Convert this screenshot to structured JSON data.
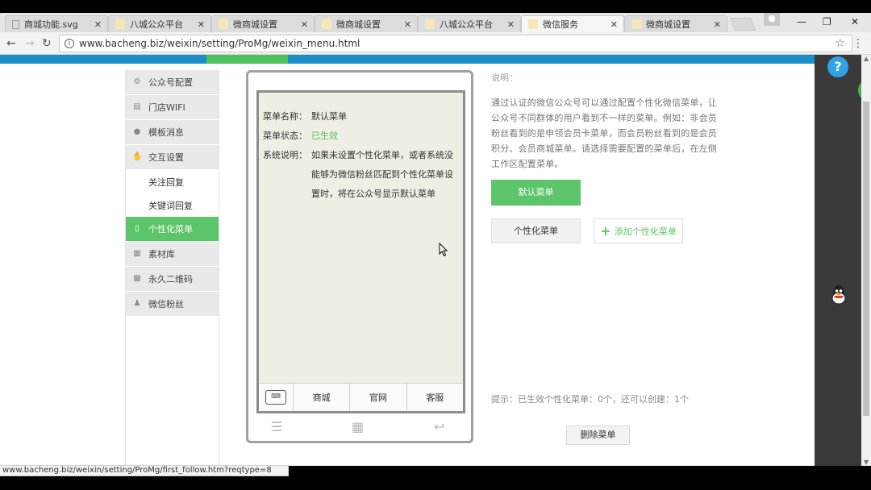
{
  "browser": {
    "tabs": [
      {
        "title": "商城功能.svg",
        "icon": "page-icon",
        "active": false
      },
      {
        "title": "八城公众平台",
        "icon": "site-icon",
        "active": false
      },
      {
        "title": "微商城设置",
        "icon": "site-icon",
        "active": false
      },
      {
        "title": "微商城设置",
        "icon": "site-icon",
        "active": false
      },
      {
        "title": "八城公众平台",
        "icon": "site-icon",
        "active": false
      },
      {
        "title": "微信服务",
        "icon": "site-icon",
        "active": true
      },
      {
        "title": "微商城设置",
        "icon": "site-icon",
        "active": false
      }
    ],
    "url": "www.bacheng.biz/weixin/setting/ProMg/weixin_menu.html",
    "status_url": "www.bacheng.biz/weixin/setting/ProMg/first_follow.htm?reqtype=8"
  },
  "sidebar": {
    "items": [
      {
        "label": "公众号配置",
        "icon": "gear-icon",
        "active": false
      },
      {
        "label": "门店WIFI",
        "icon": "wifi-icon",
        "active": false
      },
      {
        "label": "模板消息",
        "icon": "user-icon",
        "active": false
      },
      {
        "label": "交互设置",
        "icon": "hand-icon",
        "active": false
      },
      {
        "label": "关注回复",
        "sub": true
      },
      {
        "label": "关键词回复",
        "sub": true
      },
      {
        "label": "个性化菜单",
        "icon": "phone-icon",
        "active": true
      },
      {
        "label": "素材库",
        "icon": "library-icon",
        "active": false
      },
      {
        "label": "永久二维码",
        "icon": "qrcode-icon",
        "active": false
      },
      {
        "label": "微信粉丝",
        "icon": "fans-icon",
        "active": false
      }
    ]
  },
  "phone": {
    "menu_name_label": "菜单名称：",
    "menu_name_value": "默认菜单",
    "menu_status_label": "菜单状态：",
    "menu_status_value": "已生效",
    "sys_desc_label": "系统说明：",
    "sys_desc_value": "如果未设置个性化菜单，或者系统没能够为微信粉丝匹配到个性化菜单设置时，将在公众号显示默认菜单",
    "menu_buttons": [
      "商城",
      "官网",
      "客服"
    ]
  },
  "content": {
    "label": "说明：",
    "paragraph": "通过认证的微信公众号可以通过配置个性化微信菜单，让公众号不同群体的用户看到不一样的菜单。例如：非会员粉丝看到的是申领会员卡菜单，而会员粉丝看到的是会员积分、会员商城菜单。请选择需要配置的菜单后，在左侧工作区配置菜单。",
    "default_menu_button": "默认菜单",
    "personal_menu_button": "个性化菜单",
    "add_menu_button": "添加个性化菜单",
    "tip": "提示：已生效个性化菜单：0个，还可以创建：1个",
    "delete_button": "删除菜单"
  },
  "colors": {
    "accent_green": "#5cc469",
    "brand_blue": "#1c8fc8",
    "help_blue": "#30a2e6"
  }
}
